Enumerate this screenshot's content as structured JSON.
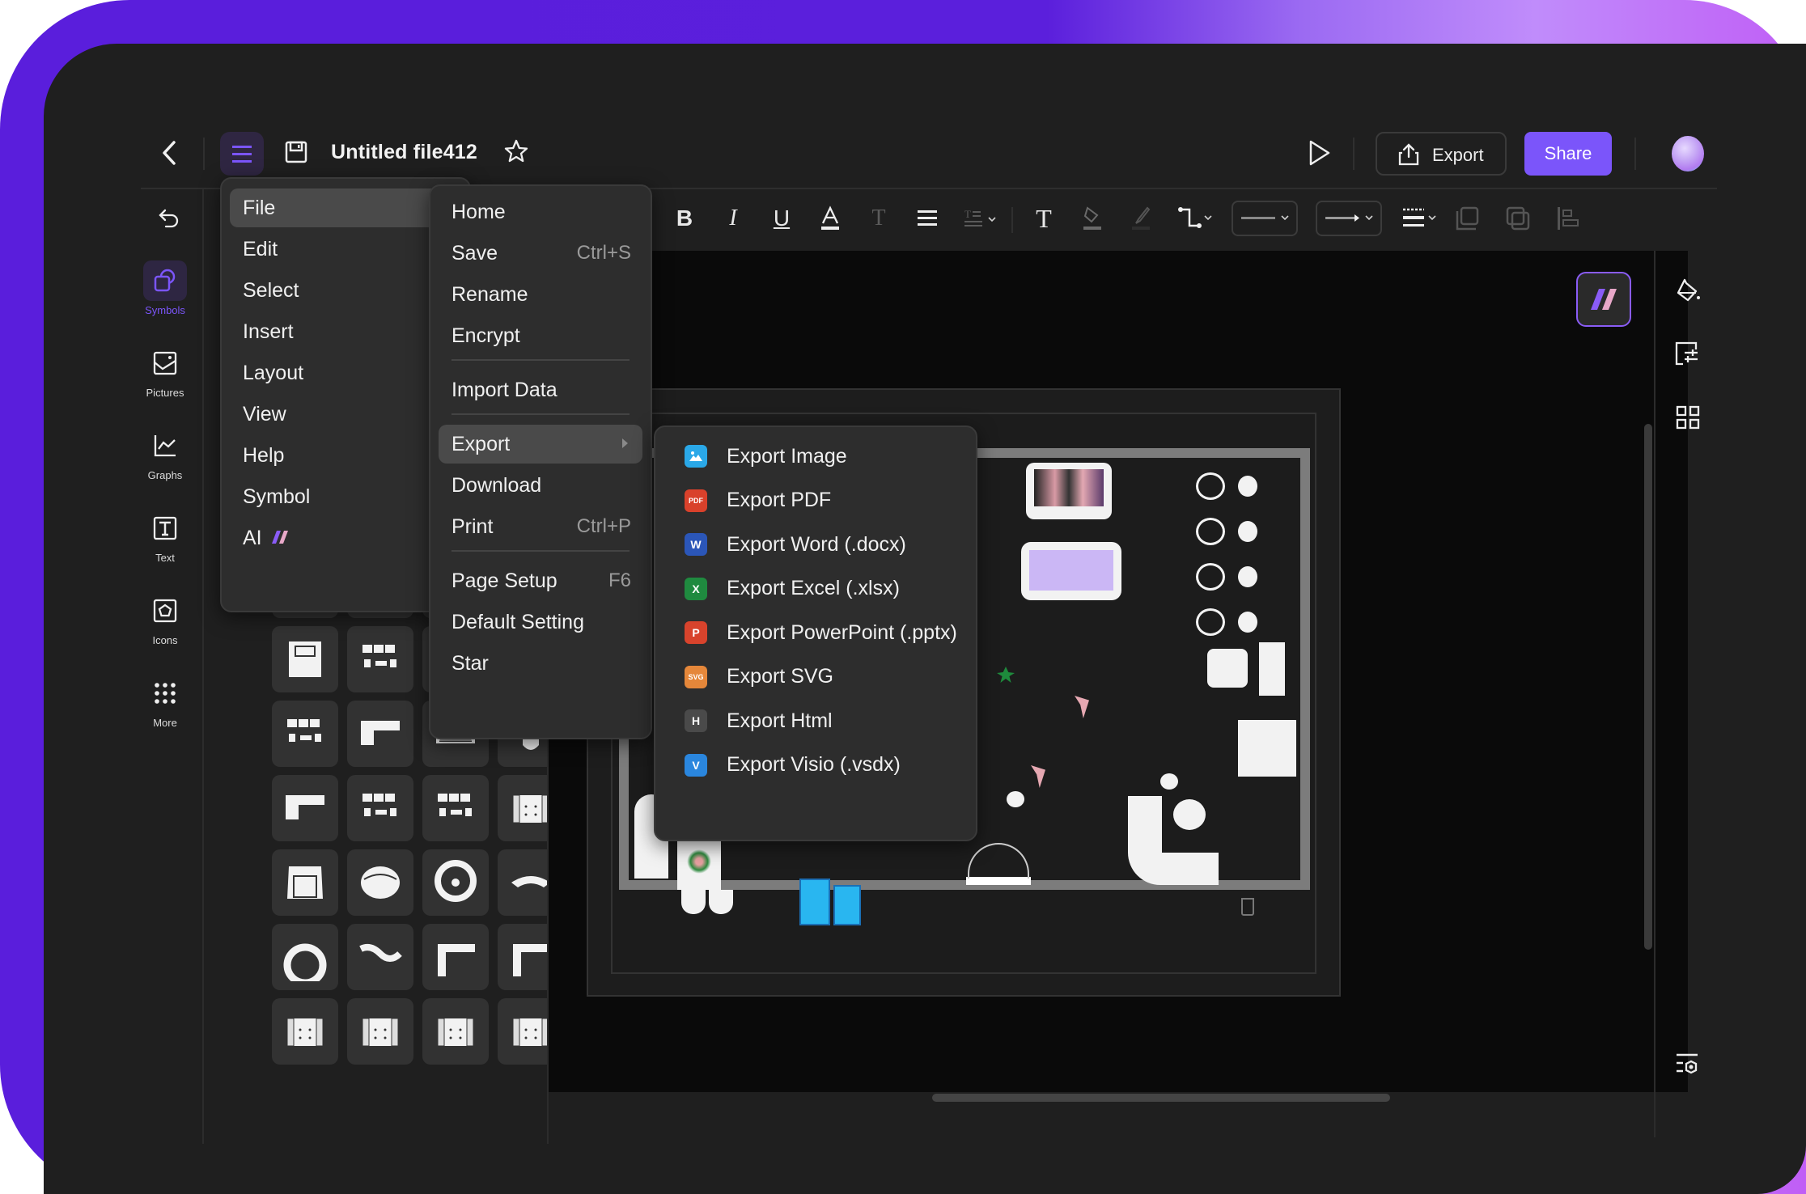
{
  "header": {
    "title": "Untitled file412",
    "export_label": "Export",
    "share_label": "Share",
    "icons": [
      "back-arrow",
      "hamburger-menu",
      "save-disk",
      "star",
      "play",
      "export-upload",
      "avatar"
    ]
  },
  "toolbar": {
    "icons": [
      "undo",
      "bold",
      "italic",
      "underline",
      "font-color",
      "text-strike",
      "align",
      "text-spacing",
      "text-tool",
      "fill-bucket",
      "brush",
      "connector",
      "line-style-select",
      "arrow-style-select",
      "line-weight",
      "bring-front",
      "send-back",
      "align-left"
    ]
  },
  "sidebar": {
    "items": [
      {
        "label": "Symbols",
        "icon": "symbols-icon",
        "active": true
      },
      {
        "label": "Pictures",
        "icon": "picture-icon",
        "active": false
      },
      {
        "label": "Graphs",
        "icon": "graph-icon",
        "active": false
      },
      {
        "label": "Text",
        "icon": "text-icon",
        "active": false
      },
      {
        "label": "Icons",
        "icon": "icons-icon",
        "active": false
      },
      {
        "label": "More",
        "icon": "grid-dots-icon",
        "active": false
      }
    ]
  },
  "main_menu": {
    "items": [
      {
        "label": "File",
        "has_submenu": true,
        "highlighted": true
      },
      {
        "label": "Edit",
        "has_submenu": true
      },
      {
        "label": "Select",
        "has_submenu": true
      },
      {
        "label": "Insert",
        "has_submenu": true
      },
      {
        "label": "Layout",
        "has_submenu": true
      },
      {
        "label": "View",
        "has_submenu": true
      },
      {
        "label": "Help",
        "has_submenu": true
      },
      {
        "label": "Symbol",
        "has_submenu": true
      },
      {
        "label": "AI",
        "has_submenu": true
      }
    ]
  },
  "file_menu": {
    "items": [
      {
        "label": "Home",
        "shortcut": ""
      },
      {
        "label": "Save",
        "shortcut": "Ctrl+S"
      },
      {
        "label": "Rename",
        "shortcut": ""
      },
      {
        "label": "Encrypt",
        "shortcut": ""
      },
      {
        "label": "Import Data",
        "shortcut": ""
      },
      {
        "label": "Export",
        "shortcut": "",
        "has_submenu": true,
        "highlighted": true
      },
      {
        "label": "Download",
        "shortcut": ""
      },
      {
        "label": "Print",
        "shortcut": "Ctrl+P"
      },
      {
        "label": "Page Setup",
        "shortcut": "F6"
      },
      {
        "label": "Default Setting",
        "shortcut": ""
      },
      {
        "label": "Star",
        "shortcut": ""
      }
    ]
  },
  "export_menu": {
    "items": [
      {
        "label": "Export Image",
        "badge": "",
        "color": "#2aa8e8"
      },
      {
        "label": "Export PDF",
        "badge": "PDF",
        "color": "#d9412b"
      },
      {
        "label": "Export Word (.docx)",
        "badge": "W",
        "color": "#2b56b8"
      },
      {
        "label": "Export Excel (.xlsx)",
        "badge": "X",
        "color": "#1f8a3f"
      },
      {
        "label": "Export PowerPoint (.pptx)",
        "badge": "P",
        "color": "#d8432c"
      },
      {
        "label": "Export SVG",
        "badge": "SVG",
        "color": "#e5873a"
      },
      {
        "label": "Export Html",
        "badge": "H",
        "color": "#4a4a4a"
      },
      {
        "label": "Export Visio (.vsdx)",
        "badge": "V",
        "color": "#2a86de"
      }
    ]
  },
  "right_rail": {
    "icons": [
      "ai-assistant",
      "paint-bucket",
      "format-panel",
      "grid-view",
      "page-settings"
    ]
  },
  "colors": {
    "accent": "#7b55fa",
    "panel": "#1f1f1f",
    "canvas": "#0a0a0a",
    "menu": "#2d2d2d",
    "menu_highlight": "#4a4a4a"
  }
}
